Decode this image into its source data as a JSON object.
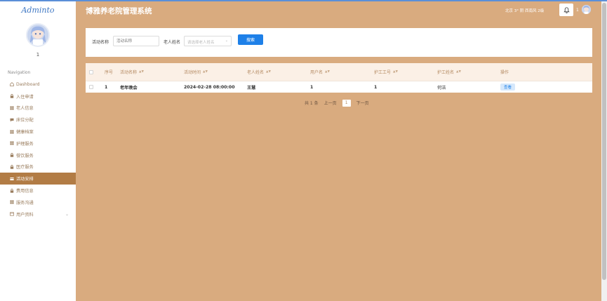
{
  "sidebar": {
    "logo": "Adminto",
    "user_number": "1",
    "nav_title": "Navigation",
    "items": [
      {
        "label": "Dashboard",
        "icon": "home-icon"
      },
      {
        "label": "入住申请",
        "icon": "lock-icon"
      },
      {
        "label": "老人信息",
        "icon": "grid-icon"
      },
      {
        "label": "床位分配",
        "icon": "chat-icon"
      },
      {
        "label": "健康档案",
        "icon": "grid-icon"
      },
      {
        "label": "护理服务",
        "icon": "grid-icon"
      },
      {
        "label": "餐饮服务",
        "icon": "lock-icon"
      },
      {
        "label": "医疗服务",
        "icon": "lock-icon"
      },
      {
        "label": "活动安排",
        "icon": "card-icon"
      },
      {
        "label": "费用信息",
        "icon": "lock-icon"
      },
      {
        "label": "服务沟通",
        "icon": "grid-icon"
      },
      {
        "label": "用户资料",
        "icon": "window-icon"
      }
    ],
    "active_index": 8
  },
  "header": {
    "title": "博雅养老院管理系统",
    "weather": "北京  3° 阴  西南风  2级",
    "user": "1"
  },
  "search": {
    "activity_label": "活动名称",
    "activity_placeholder": "活动名称",
    "elder_label": "老人姓名",
    "elder_placeholder": "请选择老人姓名",
    "button": "搜索"
  },
  "table": {
    "columns": [
      "序号",
      "活动名称",
      "活动时间",
      "老人姓名",
      "用户名",
      "护工工号",
      "护工姓名",
      "操作"
    ],
    "rows": [
      {
        "index": "1",
        "activity": "老年晚会",
        "time": "2024-02-28 08:00:00",
        "elder": "王慧",
        "username": "1",
        "worker_id": "1",
        "worker_name": "何洁",
        "action": "查看"
      }
    ]
  },
  "pagination": {
    "total": "共 1 条",
    "prev": "上一页",
    "current": "1",
    "next": "下一页"
  }
}
